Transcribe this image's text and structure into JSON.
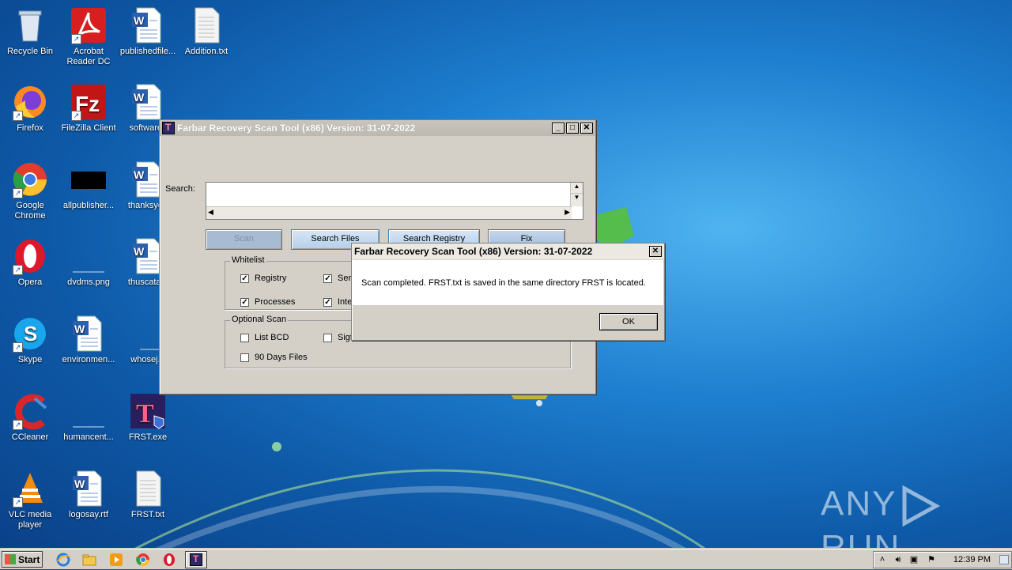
{
  "desktop": {
    "icons": [
      {
        "label": "Recycle Bin"
      },
      {
        "label": "Acrobat Reader DC"
      },
      {
        "label": "publishedfile..."
      },
      {
        "label": "Addition.txt"
      },
      {
        "label": "Firefox"
      },
      {
        "label": "FileZilla Client"
      },
      {
        "label": "softwarec"
      },
      {
        "label": "Google Chrome"
      },
      {
        "label": "allpublisher..."
      },
      {
        "label": "thanksyou"
      },
      {
        "label": "Opera"
      },
      {
        "label": "dvdms.png"
      },
      {
        "label": "thuscatalo"
      },
      {
        "label": "Skype"
      },
      {
        "label": "environmen..."
      },
      {
        "label": "whosej.p"
      },
      {
        "label": "CCleaner"
      },
      {
        "label": "humancent..."
      },
      {
        "label": "FRST.exe"
      },
      {
        "label": "VLC media player"
      },
      {
        "label": "logosay.rtf"
      },
      {
        "label": "FRST.txt"
      }
    ],
    "watermark": "ANY RUN"
  },
  "main_window": {
    "title": "Farbar Recovery Scan Tool (x86) Version: 31-07-2022",
    "search_label": "Search:",
    "buttons": {
      "scan": "Scan",
      "search_files": "Search Files",
      "search_registry": "Search Registry",
      "fix": "Fix"
    },
    "whitelist": {
      "label": "Whitelist",
      "items": [
        {
          "label": "Registry",
          "checked": true
        },
        {
          "label": "Ser",
          "checked": true
        },
        {
          "label": "Processes",
          "checked": true
        },
        {
          "label": "Inte",
          "checked": true
        }
      ]
    },
    "optional_scan": {
      "label": "Optional Scan",
      "items": [
        {
          "label": "List BCD",
          "checked": false
        },
        {
          "label": "Sigt",
          "checked": false
        },
        {
          "label": "90 Days Files",
          "checked": false
        }
      ]
    }
  },
  "dialog": {
    "title": "Farbar Recovery Scan Tool (x86) Version: 31-07-2022",
    "message": "Scan completed. FRST.txt is saved in the same directory FRST is located.",
    "ok_label": "OK"
  },
  "taskbar": {
    "start_label": "Start",
    "clock": "12:39 PM"
  }
}
